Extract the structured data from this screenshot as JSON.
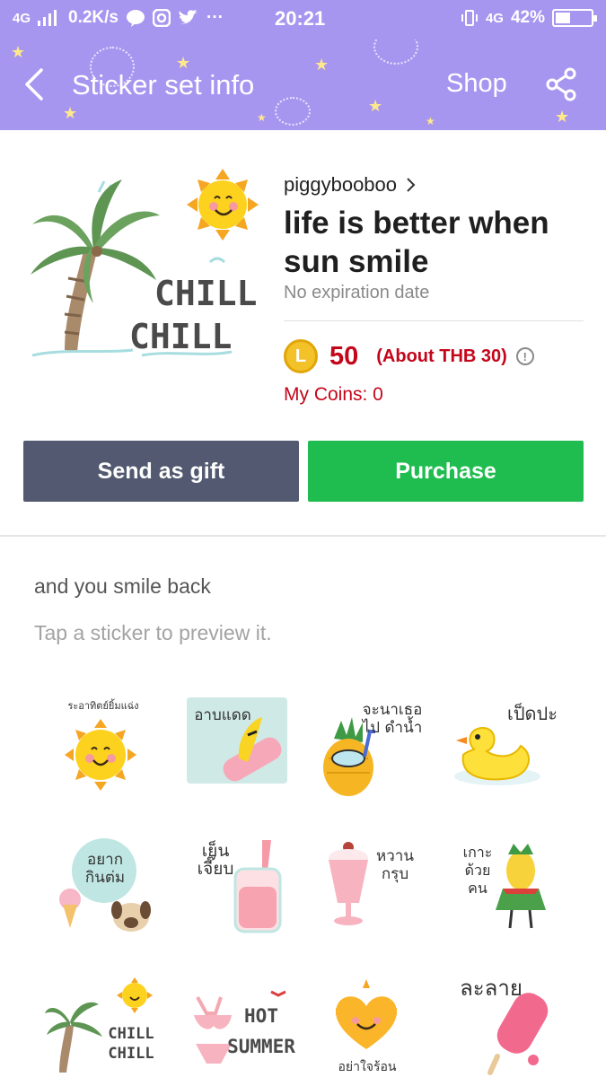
{
  "status_bar": {
    "network": "4G",
    "speed": "0.2K/s",
    "time": "20:21",
    "network_right": "4G",
    "battery": "42%",
    "battery_level": 0.42
  },
  "header": {
    "title": "Sticker set info",
    "shop": "Shop",
    "background": "#a796f0"
  },
  "product": {
    "image_text_1": "CHILL",
    "image_text_2": "CHILL",
    "author": "piggybooboo",
    "name": "life is better when sun smile",
    "expiry": "No expiration date",
    "coin_letter": "L",
    "price": "50",
    "approx_price": "(About THB 30)",
    "info_glyph": "!",
    "my_coins": "My Coins: 0"
  },
  "buttons": {
    "gift": "Send as gift",
    "purchase": "Purchase",
    "gift_color": "#525970",
    "purchase_color": "#1fbd4f"
  },
  "description": "and you smile back",
  "hint": "Tap a sticker to preview it.",
  "stickers": [
    {
      "label": "ระอาทิตย์ยิ้มแฉ่ง",
      "icon": "smiling-sun"
    },
    {
      "label": "อาบแดด",
      "icon": "banana-sunbathing"
    },
    {
      "label": "จะนาเธอ ไป ดำน้ำ",
      "icon": "pineapple-snorkel"
    },
    {
      "label": "เป็ดปะ",
      "icon": "rubber-duck"
    },
    {
      "label": "อยาก กินต่ม",
      "icon": "ice-cream-dog"
    },
    {
      "label": "เย็น เจี๊ยบ",
      "icon": "smoothie-jar"
    },
    {
      "label": "หวาน กรุบ",
      "icon": "milkshake"
    },
    {
      "label": "เกาะ ด้วย คน",
      "icon": "hula-corn"
    },
    {
      "label": "CHILL CHILL",
      "icon": "palm-sun"
    },
    {
      "label": "HOT SUMMER",
      "icon": "swimsuit"
    },
    {
      "label": "อย่าใจร้อน",
      "icon": "heart-sun"
    },
    {
      "label": "ละลาย",
      "icon": "melting-popsicle"
    }
  ]
}
